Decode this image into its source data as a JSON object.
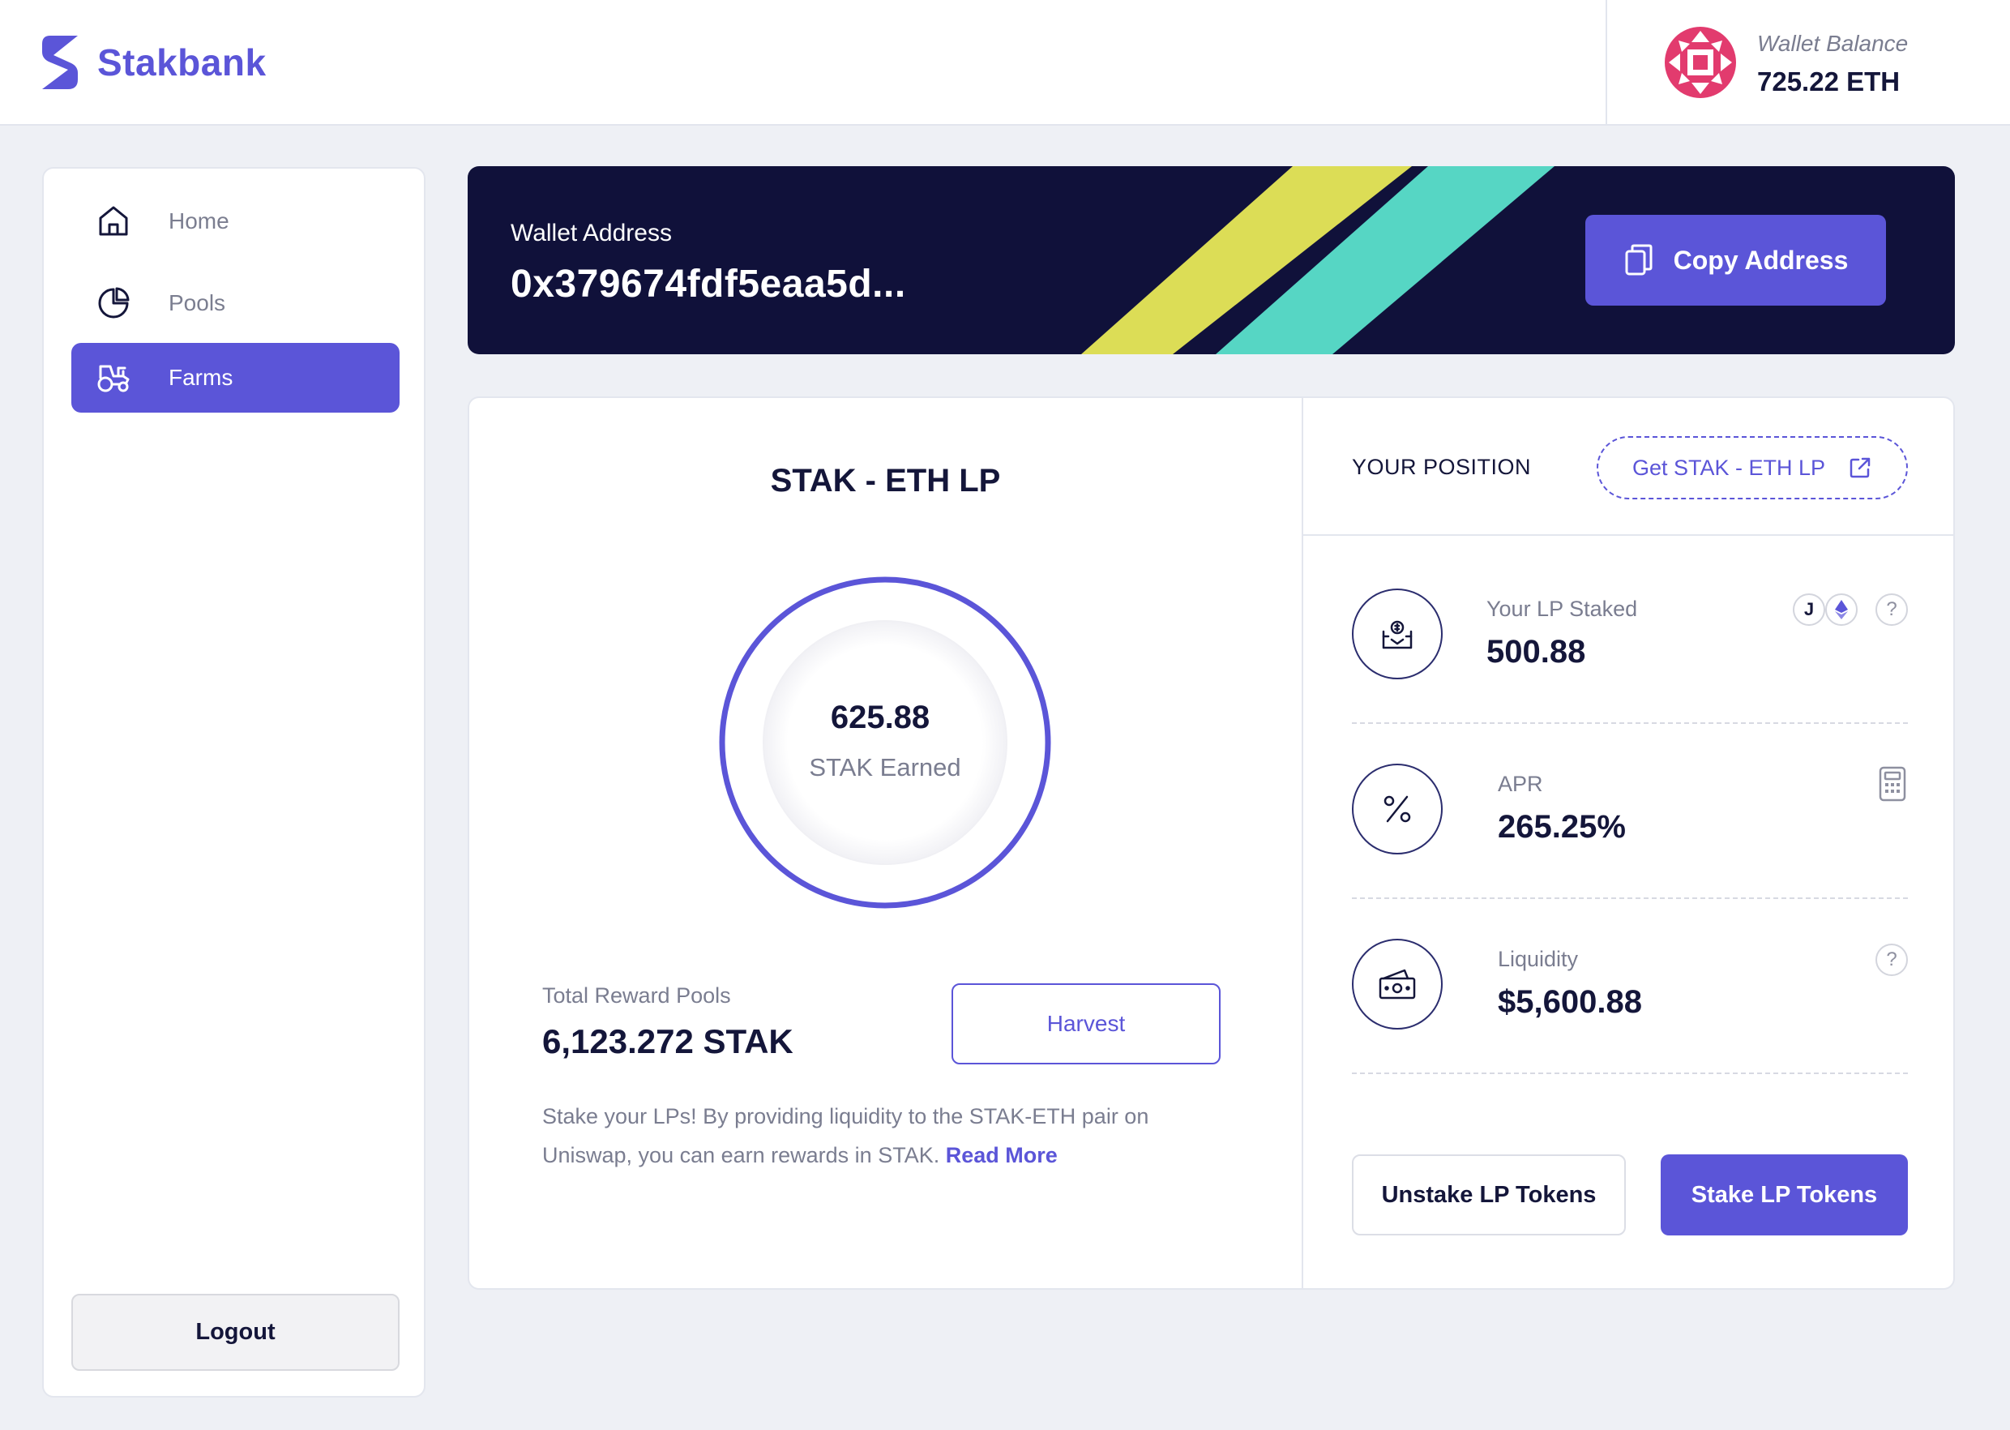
{
  "brand": {
    "name": "Stakbank",
    "color": "#5b55d8"
  },
  "wallet": {
    "balance_label": "Wallet Balance",
    "balance_value": "725.22 ETH"
  },
  "sidebar": {
    "items": [
      {
        "label": "Home",
        "icon": "home-icon",
        "active": false
      },
      {
        "label": "Pools",
        "icon": "pie-chart-icon",
        "active": false
      },
      {
        "label": "Farms",
        "icon": "tractor-icon",
        "active": true
      }
    ],
    "logout_label": "Logout"
  },
  "banner": {
    "label": "Wallet Address",
    "address": "0x379674fdf5eaa5d...",
    "copy_label": "Copy Address",
    "stripe_colors": [
      "#dcdd56",
      "#56d6c4"
    ]
  },
  "farm": {
    "title": "STAK - ETH LP",
    "earned_value": "625.88",
    "earned_label": "STAK Earned",
    "reward_label": "Total Reward Pools",
    "reward_value": "6,123.272 STAK",
    "harvest_label": "Harvest",
    "description": "Stake your LPs! By providing liquidity to the STAK-ETH pair on Uniswap, you can earn rewards in STAK.",
    "read_more": "Read More"
  },
  "position": {
    "title": "YOUR POSITION",
    "get_lp_label": "Get STAK - ETH LP",
    "stats": [
      {
        "label": "Your LP Staked",
        "value": "500.88",
        "icon": "lp-bag-icon"
      },
      {
        "label": "APR",
        "value": "265.25%",
        "icon": "percent-icon"
      },
      {
        "label": "Liquidity",
        "value": "$5,600.88",
        "icon": "cash-icon"
      }
    ],
    "token_letter": "J",
    "help_glyph": "?",
    "unstake_label": "Unstake LP Tokens",
    "stake_label": "Stake LP Tokens"
  }
}
